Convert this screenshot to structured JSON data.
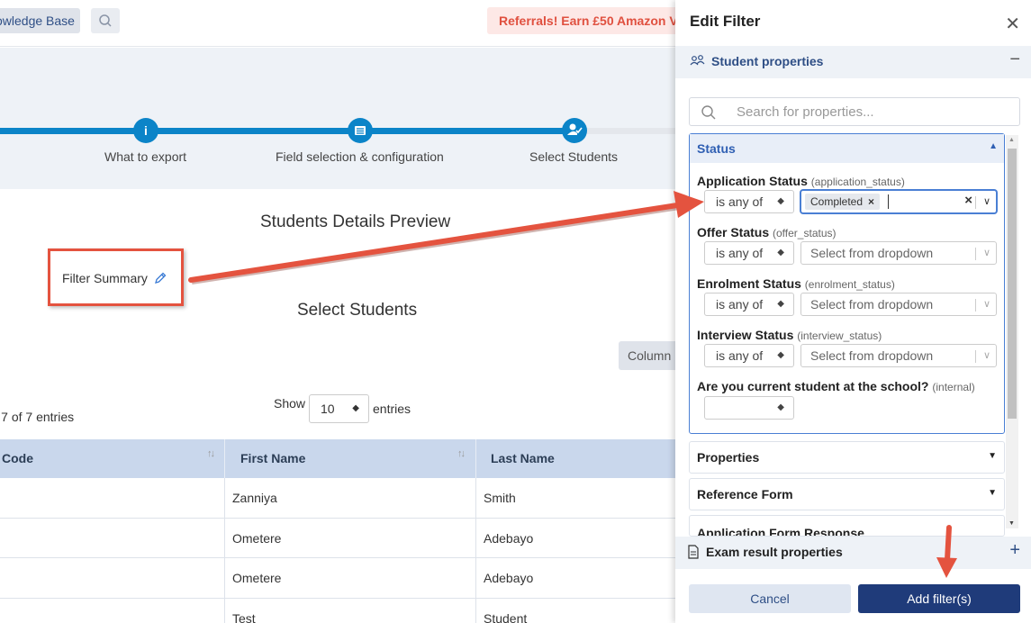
{
  "topbar": {
    "knowledge_base_label": "owledge Base",
    "referral_banner": "Referrals! Earn £50 Amazon V"
  },
  "stepper": {
    "steps": [
      {
        "label": "What to export",
        "icon": "info-icon"
      },
      {
        "label": "Field selection & configuration",
        "icon": "list-icon"
      },
      {
        "label": "Select Students",
        "icon": "user-check-icon"
      }
    ]
  },
  "main": {
    "preview_title": "Students Details Preview",
    "filter_summary_label": "Filter Summary",
    "select_students_title": "Select Students",
    "column_button": "Column",
    "show_label": "Show",
    "page_size": "10",
    "entries_label": "entries",
    "entries_count": "7 of 7 entries"
  },
  "table": {
    "columns": [
      "Code",
      "First Name",
      "Last Name"
    ],
    "rows": [
      {
        "first": "Zanniya",
        "last": "Smith"
      },
      {
        "first": "Ometere",
        "last": "Adebayo"
      },
      {
        "first": "Ometere",
        "last": "Adebayo"
      },
      {
        "first": "Test",
        "last": "Student"
      }
    ]
  },
  "panel": {
    "title": "Edit Filter",
    "student_properties_label": "Student properties",
    "search_placeholder": "Search for properties...",
    "status_section": {
      "label": "Status",
      "properties": [
        {
          "label": "Application Status",
          "key": "(application_status)",
          "operator": "is any of",
          "value_chip": "Completed",
          "placeholder": ""
        },
        {
          "label": "Offer Status",
          "key": "(offer_status)",
          "operator": "is any of",
          "placeholder": "Select from dropdown"
        },
        {
          "label": "Enrolment Status",
          "key": "(enrolment_status)",
          "operator": "is any of",
          "placeholder": "Select from dropdown"
        },
        {
          "label": "Interview Status",
          "key": "(interview_status)",
          "operator": "is any of",
          "placeholder": "Select from dropdown"
        },
        {
          "label": "Are you current student at the school?",
          "key": "(internal)",
          "operator": "",
          "placeholder": ""
        }
      ]
    },
    "accordions": [
      "Properties",
      "Reference Form",
      "Application Form Response"
    ],
    "exam_result_label": "Exam result properties",
    "cancel_label": "Cancel",
    "add_label": "Add filter(s)"
  },
  "colors": {
    "accent_blue": "#0b84c8",
    "navy_button": "#1f3b7a",
    "annotation_red": "#e4533f"
  }
}
